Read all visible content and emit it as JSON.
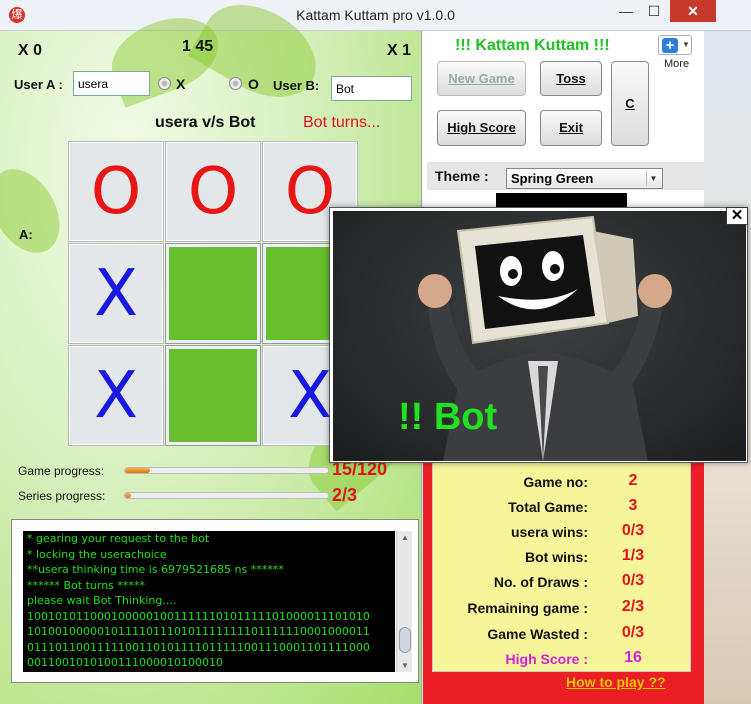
{
  "window": {
    "title": "Kattam Kuttam pro v1.0.0",
    "app_icon": "爆",
    "min": "—",
    "max": "☐",
    "close": "✕"
  },
  "header": {
    "score_a": "X 0",
    "timer": "1 45",
    "score_b": "X 1"
  },
  "users": {
    "usera_label": "User A :",
    "usera_value": "usera",
    "userb_label": "User B:",
    "userb_value": "Bot",
    "radio_x": "X",
    "radio_o": "O"
  },
  "versus": "usera v/s Bot",
  "turn_status": "Bot turns...",
  "a_label": "A:",
  "board": [
    [
      "O",
      "O",
      "O"
    ],
    [
      "X",
      "",
      ""
    ],
    [
      "X",
      "",
      "X"
    ]
  ],
  "progress": {
    "game_label": "Game progress:",
    "game_value": "15/120",
    "game_fraction": 0.125,
    "series_label": "Series progress:",
    "series_value": "2/3",
    "series_fraction": 0.03
  },
  "console": {
    "lines": [
      " * gearing your   request to the bot",
      " * locking the userachoice",
      "  **usera  thinking time is  6979521685 ns ******",
      "  ****** Bot turns *****",
      "  please wait Bot Thinking....",
      "1001010110001000001001111110101111101000011101010",
      "1010010000010111101110101111111101111110001000011",
      "0111011001111100110101111011111001110001101111000",
      "0011001010100111000010100010"
    ]
  },
  "right": {
    "app_name": "!!! Kattam Kuttam !!!",
    "more_label": "More",
    "buttons": {
      "new_game": "New Game",
      "toss": "Toss",
      "c": "C",
      "high_score": "High Score",
      "exit": "Exit"
    },
    "theme_label": "Theme :",
    "theme_value": "Spring Green",
    "stats": [
      {
        "label": "Game no:",
        "value": "2"
      },
      {
        "label": "Total Game:",
        "value": "3"
      },
      {
        "label": "usera wins:",
        "value": "0/3"
      },
      {
        "label": "Bot wins:",
        "value": "1/3"
      },
      {
        "label": "No. of Draws :",
        "value": "0/3"
      },
      {
        "label": "Remaining game :",
        "value": "2/3"
      },
      {
        "label": "Game Wasted :",
        "value": "0/3"
      },
      {
        "label": "High Score :",
        "value": "16"
      }
    ],
    "how_to_play": "How to play ??"
  },
  "popup": {
    "text": "!! Bot",
    "close": "✕"
  },
  "colors": {
    "green": "#67bf2c",
    "red": "#e0141e",
    "blue": "#1818e0",
    "stats_bg": "#f7f59a",
    "highscore": "#d61fd6"
  }
}
